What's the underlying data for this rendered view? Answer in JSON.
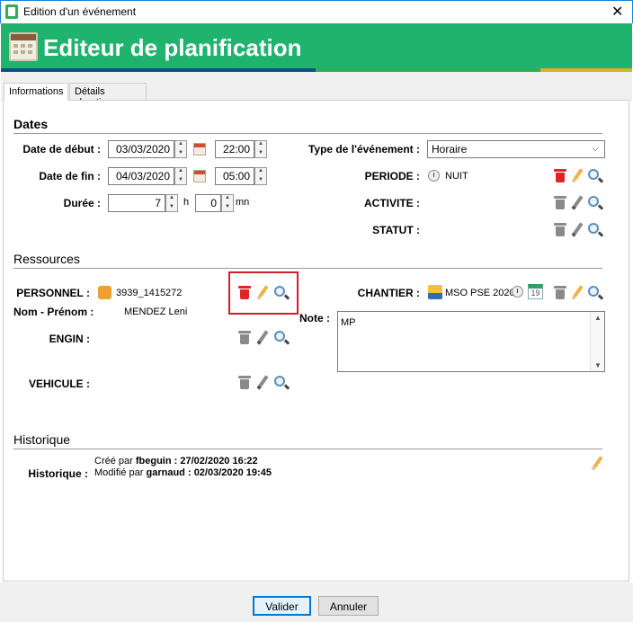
{
  "window": {
    "title": "Edition d'un événement",
    "close": "✕"
  },
  "banner": {
    "title": "Editeur de planification"
  },
  "tabs": [
    {
      "label": "Informations"
    },
    {
      "label": "Détails chantier"
    }
  ],
  "dates": {
    "section_title": "Dates",
    "start_label": "Date de début :",
    "start_date": "03/03/2020",
    "start_time": "22:00",
    "end_label": "Date de fin :",
    "end_date": "04/03/2020",
    "end_time": "05:00",
    "duration_label": "Durée :",
    "duration_hours": "7",
    "hours_unit": "h",
    "duration_minutes": "0",
    "minutes_unit": "mn",
    "event_type_label": "Type de l'événement :",
    "event_type_value": "Horaire",
    "periode_label": "PERIODE :",
    "periode_value": "NUIT",
    "activite_label": "ACTIVITE :",
    "statut_label": "STATUT :"
  },
  "resources": {
    "section_title": "Ressources",
    "personnel_label": "PERSONNEL :",
    "personnel_value": "3939_1415272",
    "nom_label": "Nom - Prénom :",
    "nom_value": "MENDEZ Leni",
    "engin_label": "ENGIN :",
    "vehicule_label": "VEHICULE :",
    "chantier_label": "CHANTIER :",
    "chantier_value": "MSO PSE 2020",
    "calendar_day": "19",
    "note_label": "Note :",
    "note_value": "MP"
  },
  "history": {
    "section_title": "Historique",
    "label": "Historique :",
    "created_prefix": "Créé par",
    "created_by": "fbeguin",
    "created_sep": ":",
    "created_at": "27/02/2020 16:22",
    "modified_prefix": "Modifié par",
    "modified_by": "garnaud",
    "modified_sep": ":",
    "modified_at": "02/03/2020 19:45"
  },
  "buttons": {
    "validate": "Valider",
    "cancel": "Annuler"
  },
  "colors": {
    "banner": "#1fb36e",
    "highlight_border": "#d21f2a",
    "stripe": [
      "#0e4f8a",
      "#2fae5a",
      "#d7b420"
    ]
  }
}
